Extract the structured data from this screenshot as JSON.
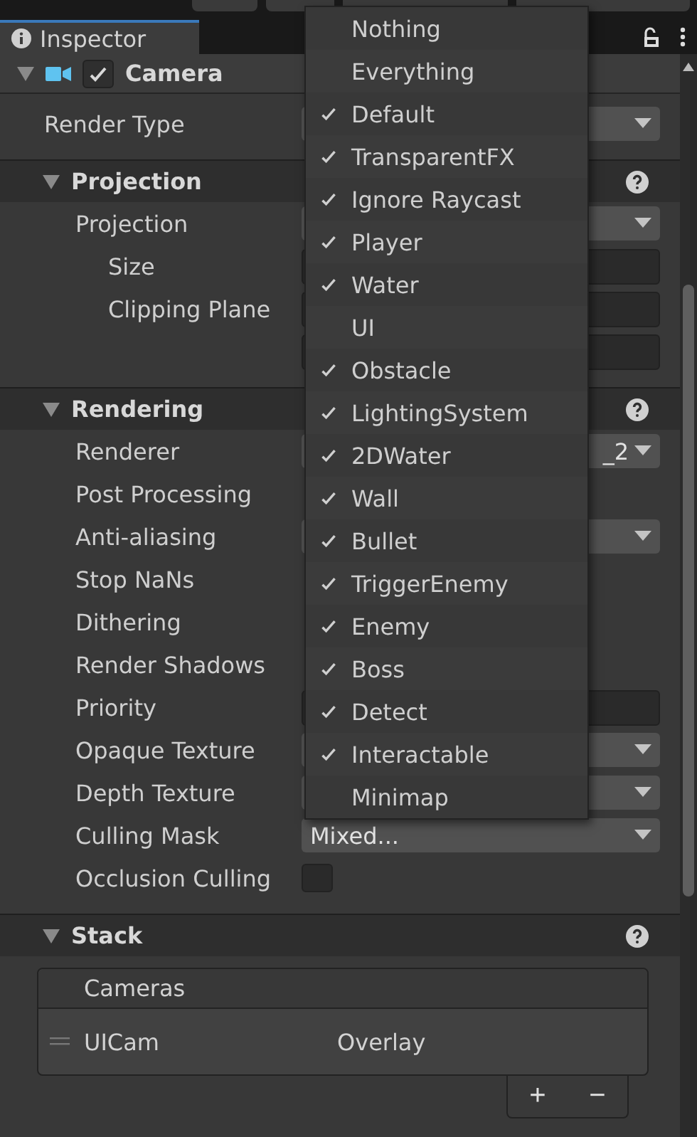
{
  "tab": {
    "label": "Inspector",
    "selected": true
  },
  "component": {
    "title": "Camera",
    "enabled": true,
    "expanded": true
  },
  "top_rows": [
    {
      "label": "Render Type",
      "kind": "dropdown"
    }
  ],
  "sections": [
    {
      "title": "Projection",
      "expanded": true,
      "rows": [
        {
          "label": "Projection",
          "kind": "dropdown",
          "children": [
            {
              "label": "Size",
              "kind": "number"
            },
            {
              "label": "Clipping Plane",
              "kind": "number"
            },
            {
              "kind": "number"
            }
          ]
        }
      ]
    },
    {
      "title": "Rendering",
      "expanded": true,
      "rows": [
        {
          "label": "Renderer",
          "kind": "dropdown",
          "value": "_2"
        },
        {
          "label": "Post Processing",
          "kind": "blank"
        },
        {
          "label": "Anti-aliasing",
          "kind": "dropdown"
        },
        {
          "label": "Stop NaNs",
          "kind": "blank"
        },
        {
          "label": "Dithering",
          "kind": "blank"
        },
        {
          "label": "Render Shadows",
          "kind": "blank"
        },
        {
          "label": "Priority",
          "kind": "number"
        },
        {
          "label": "Opaque Texture",
          "kind": "dropdown"
        },
        {
          "label": "Depth Texture",
          "kind": "dropdown"
        },
        {
          "label": "Culling Mask",
          "kind": "dropdown",
          "value": "Mixed..."
        },
        {
          "label": "Occlusion Culling",
          "kind": "checkbox",
          "checked": false
        }
      ]
    }
  ],
  "stack": {
    "title": "Stack",
    "expanded": true,
    "list_header": "Cameras",
    "cameras": [
      {
        "name": "UICam",
        "type": "Overlay"
      }
    ],
    "add": "+",
    "remove": "−"
  },
  "menu": [
    {
      "label": "Nothing",
      "checked": false
    },
    {
      "label": "Everything",
      "checked": false
    },
    {
      "label": "Default",
      "checked": true
    },
    {
      "label": "TransparentFX",
      "checked": true
    },
    {
      "label": "Ignore Raycast",
      "checked": true
    },
    {
      "label": "Player",
      "checked": true
    },
    {
      "label": "Water",
      "checked": true
    },
    {
      "label": "UI",
      "checked": false
    },
    {
      "label": "Obstacle",
      "checked": true
    },
    {
      "label": "LightingSystem",
      "checked": true
    },
    {
      "label": "2DWater",
      "checked": true
    },
    {
      "label": "Wall",
      "checked": true
    },
    {
      "label": "Bullet",
      "checked": true
    },
    {
      "label": "TriggerEnemy",
      "checked": true
    },
    {
      "label": "Enemy",
      "checked": true
    },
    {
      "label": "Boss",
      "checked": true
    },
    {
      "label": "Detect",
      "checked": true
    },
    {
      "label": "Interactable",
      "checked": true
    },
    {
      "label": "Minimap",
      "checked": false
    }
  ]
}
